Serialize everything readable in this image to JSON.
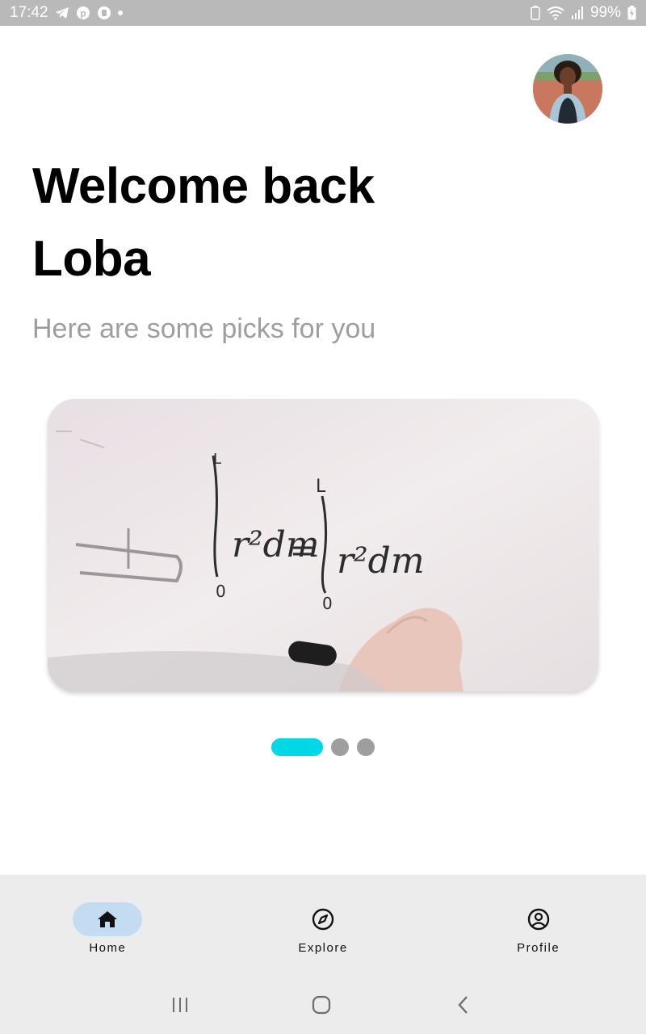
{
  "status_bar": {
    "time": "17:42",
    "battery": "99%",
    "icons": [
      "telegram-icon",
      "pinterest-icon",
      "vpn-icon",
      "notification-dot-icon",
      "battery-saver-icon",
      "wifi-icon",
      "signal-icon",
      "battery-charging-icon"
    ]
  },
  "header": {
    "greeting_line1": "Welcome back",
    "greeting_line2": "Loba",
    "subtitle": "Here are some picks for you"
  },
  "carousel": {
    "slide_count": 3,
    "active_index": 0,
    "whiteboard_text": "∫r²dm = ∫r²dm",
    "colors": {
      "active_dot": "#00d8e8",
      "inactive_dot": "#9e9e9e"
    }
  },
  "bottom_nav": {
    "items": [
      {
        "label": "Home",
        "icon": "home-icon",
        "active": true
      },
      {
        "label": "Explore",
        "icon": "compass-icon",
        "active": false
      },
      {
        "label": "Profile",
        "icon": "account-circle-icon",
        "active": false
      }
    ],
    "colors": {
      "active_pill": "#c4dcf2",
      "background": "#ececec"
    }
  },
  "system_nav": {
    "buttons": [
      "recent-apps-icon",
      "home-circle-icon",
      "back-icon"
    ]
  }
}
